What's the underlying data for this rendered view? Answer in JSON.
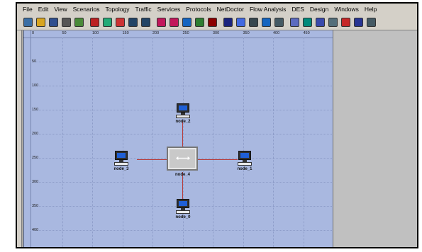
{
  "menu": [
    "File",
    "Edit",
    "View",
    "Scenarios",
    "Topology",
    "Traffic",
    "Services",
    "Protocols",
    "NetDoctor",
    "Flow Analysis",
    "DES",
    "Design",
    "Windows",
    "Help"
  ],
  "toolbar_icons": [
    "new-project-icon",
    "open-folder-icon",
    "save-icon",
    "print-icon",
    "object-palette-icon",
    "failure-icon",
    "recover-icon",
    "edit-attributes-icon",
    "zoom-in-icon",
    "zoom-out-icon",
    "traffic-import-icon",
    "traffic-export-icon",
    "traffic-view-icon",
    "configure-icon",
    "hide-links-icon",
    "view-results-icon",
    "grid-icon",
    "flow-analysis-icon",
    "link-utilization-icon",
    "path-icon",
    "chart-icon",
    "statistics-icon",
    "compare-icon",
    "report-icon",
    "undo-icon",
    "web-report-icon",
    "table-icon"
  ],
  "ruler": {
    "x_ticks": [
      "0",
      "50",
      "100",
      "150",
      "200",
      "250",
      "300",
      "350",
      "400",
      "450",
      "5"
    ],
    "y_ticks": [
      "50",
      "100",
      "150",
      "200",
      "250",
      "300",
      "350",
      "400"
    ]
  },
  "nodes": [
    {
      "id": "node_2",
      "label": "node_2"
    },
    {
      "id": "node_3",
      "label": "node_3"
    },
    {
      "id": "node_4",
      "label": "node_4"
    },
    {
      "id": "node_1",
      "label": "node_1"
    },
    {
      "id": "node_0",
      "label": "node_0"
    }
  ],
  "colors": {
    "workspace": "#a9b8e0",
    "link": "#b53a3a",
    "screen": "#1f5fd6"
  }
}
